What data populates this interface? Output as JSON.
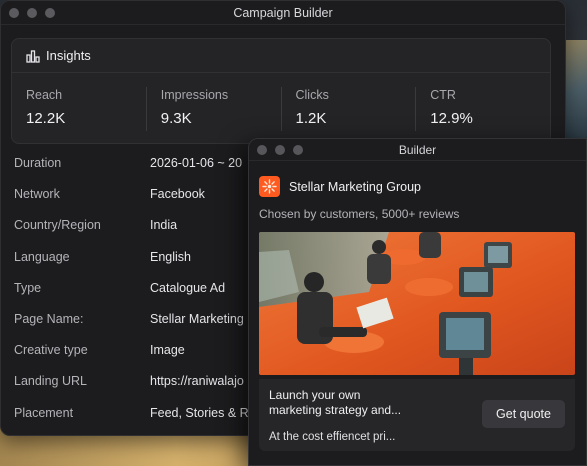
{
  "main_window": {
    "title": "Campaign Builder",
    "insights": {
      "title": "Insights",
      "icon": "bar-chart-icon",
      "metrics": [
        {
          "label": "Reach",
          "value": "12.2K"
        },
        {
          "label": "Impressions",
          "value": "9.3K"
        },
        {
          "label": "Clicks",
          "value": "1.2K"
        },
        {
          "label": "CTR",
          "value": "12.9%"
        }
      ]
    },
    "details": [
      {
        "label": "Duration",
        "value": "2026-01-06 ~ 20"
      },
      {
        "label": "Network",
        "value": "Facebook"
      },
      {
        "label": "Country/Region",
        "value": "India"
      },
      {
        "label": "Language",
        "value": "English"
      },
      {
        "label": "Type",
        "value": "Catalogue Ad"
      },
      {
        "label": "Page Name:",
        "value": "Stellar Marketing"
      },
      {
        "label": "Creative type",
        "value": "Image"
      },
      {
        "label": "Landing URL",
        "value": "https://raniwalajo"
      },
      {
        "label": "Placement",
        "value": "Feed, Stories & R"
      }
    ]
  },
  "builder": {
    "title": "Builder",
    "brand_name": "Stellar Marketing Group",
    "brand_icon": "starburst-logo-icon",
    "tagline": "Chosen by customers, 5000+ reviews",
    "headline_line1": "Launch your own",
    "headline_line2": "marketing strategy and...",
    "subline": "At the cost effiencet pri...",
    "cta_label": "Get quote"
  },
  "colors": {
    "window_bg": "#1c1c1e",
    "card_bg": "#242426",
    "brand_accent": "#ff5a1f",
    "ad_floor": "#e8642a"
  }
}
